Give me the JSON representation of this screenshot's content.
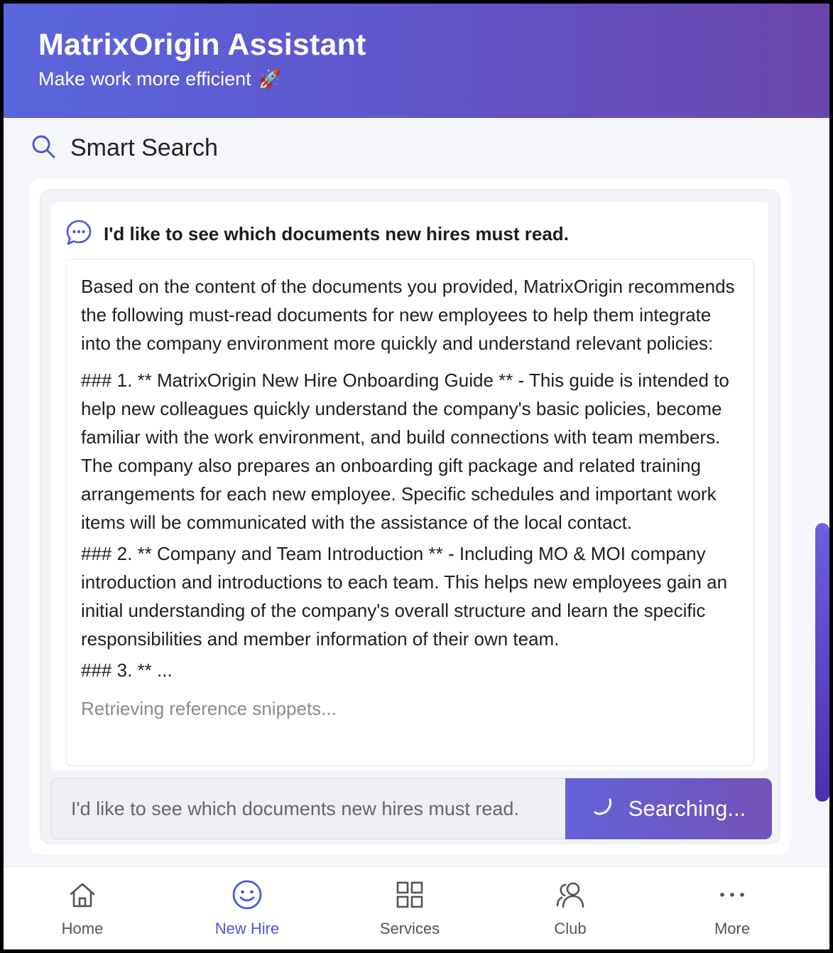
{
  "header": {
    "title": "MatrixOrigin Assistant",
    "subtitle": "Make work more efficient",
    "subtitle_emoji": "🚀"
  },
  "section": {
    "title": "Smart Search",
    "icon": "search-icon"
  },
  "query": {
    "icon": "chat-bubble-icon",
    "text": "I'd like to see which documents new hires must read."
  },
  "answer": {
    "intro": "Based on the content of the documents you provided, MatrixOrigin recommends the following must-read documents for new employees to help them integrate into the company environment more quickly and understand relevant policies:",
    "item1": "### 1. ** MatrixOrigin New Hire Onboarding Guide ** - This guide is intended to help new colleagues quickly understand the company's basic policies, become familiar with the work environment, and build connections with team members. The company also prepares an onboarding gift package and related training arrangements for each new employee. Specific schedules and important work items will be communicated with the assistance of the local contact.",
    "item2": "### 2. ** Company and Team Introduction ** - Including MO & MOI company introduction and introductions to each team. This helps new employees gain an initial understanding of the company's overall structure and learn the specific responsibilities and member information of their own team.",
    "item3": "### 3. ** ...",
    "status": "Retrieving reference snippets..."
  },
  "input": {
    "value": "I'd like to see which documents new hires must read.",
    "button_label": "Searching..."
  },
  "colors": {
    "accent": "#4b56d8",
    "header_start": "#5a66dc",
    "header_end": "#6a46ac"
  },
  "nav": {
    "items": [
      {
        "label": "Home",
        "icon": "home-icon",
        "active": false
      },
      {
        "label": "New Hire",
        "icon": "smiley-icon",
        "active": true
      },
      {
        "label": "Services",
        "icon": "grid-icon",
        "active": false
      },
      {
        "label": "Club",
        "icon": "users-icon",
        "active": false
      },
      {
        "label": "More",
        "icon": "more-icon",
        "active": false
      }
    ]
  }
}
